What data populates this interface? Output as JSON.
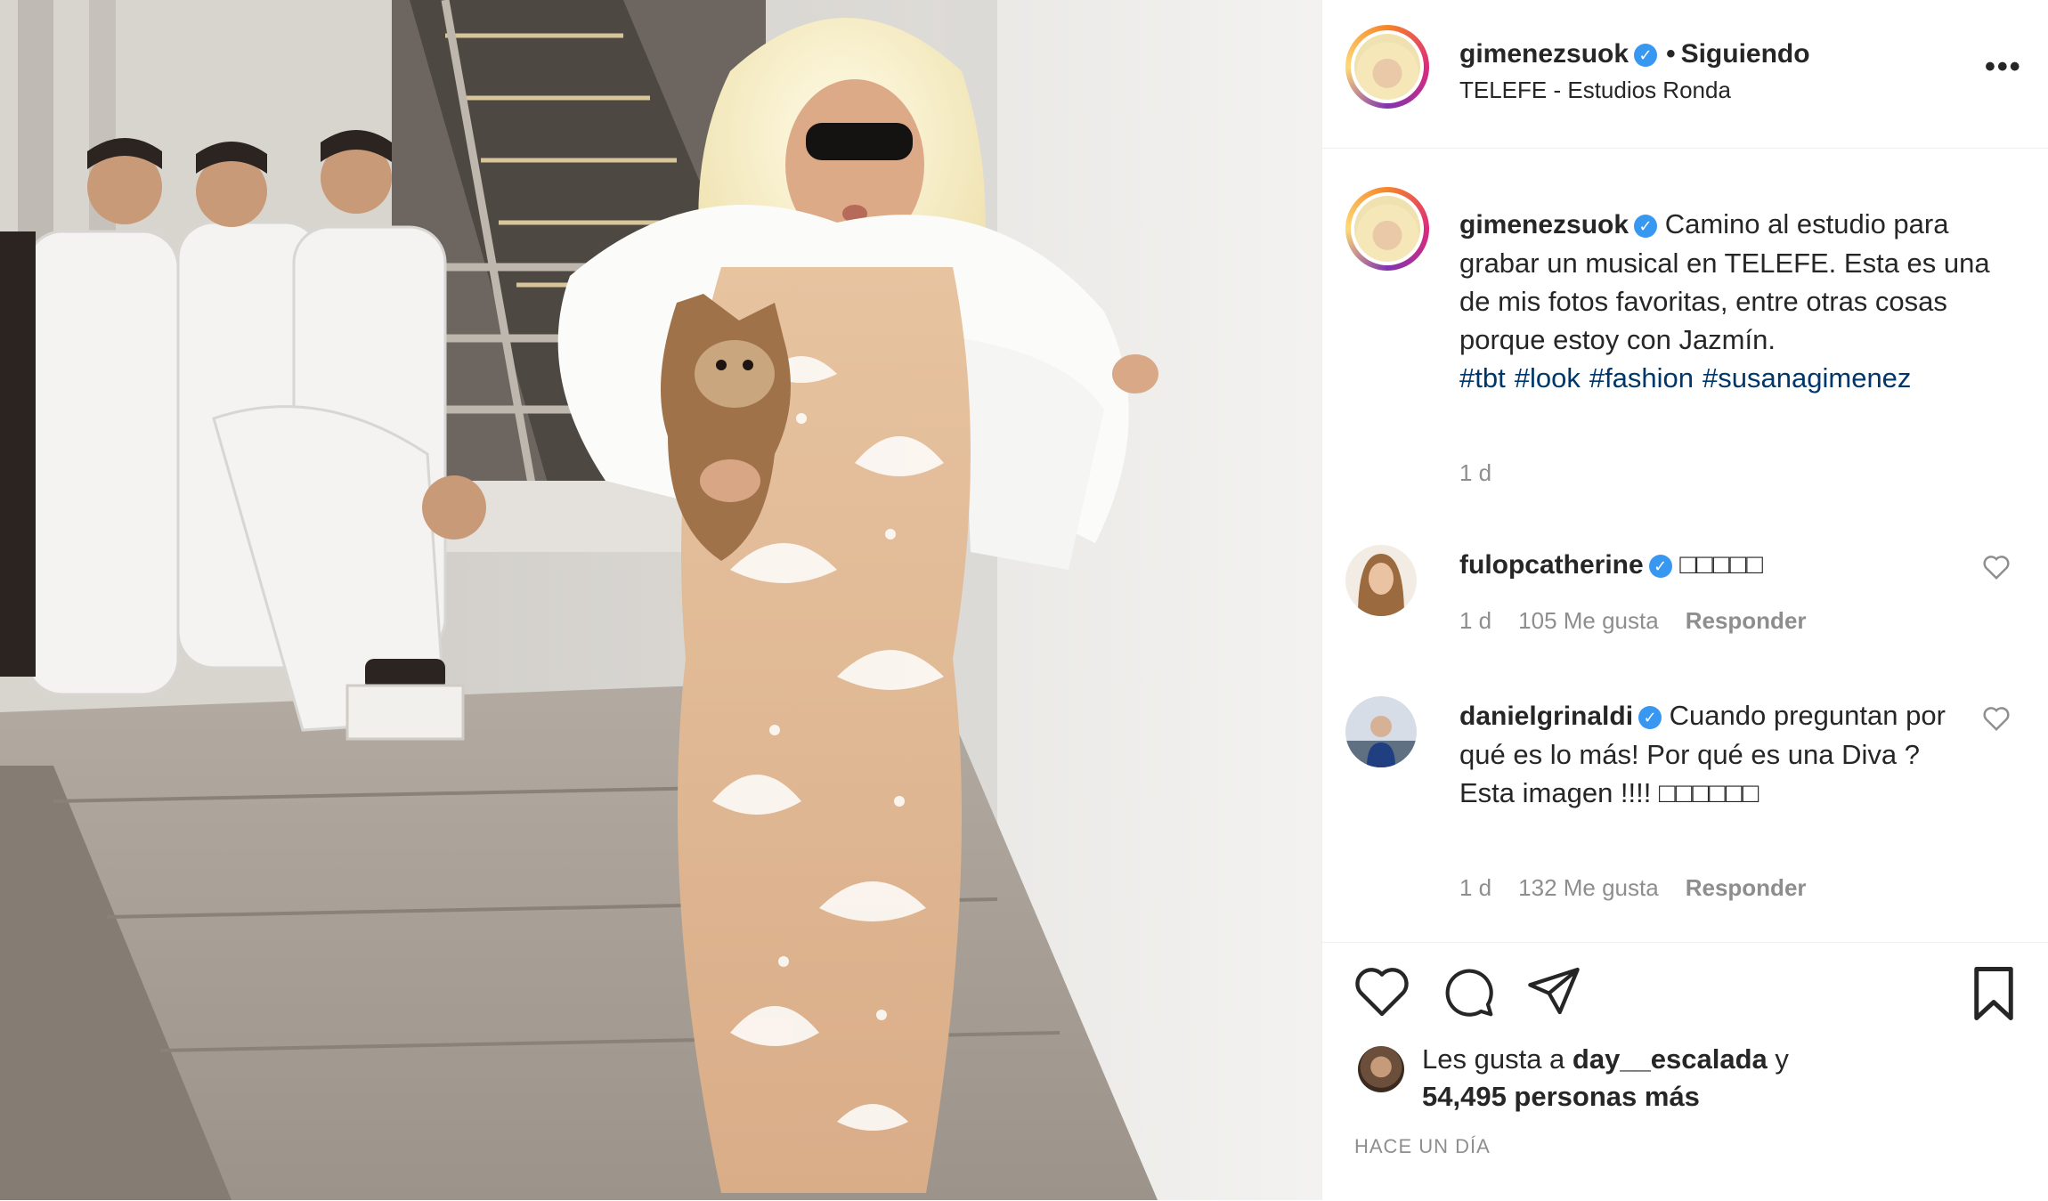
{
  "post": {
    "image_alt": "Mujer rubia con gafas oscuras, vestido de encaje y estola blanca de piel, sosteniendo un perro; detrás hombres con frac blanco"
  },
  "header": {
    "username": "gimenezsuok",
    "dot": "•",
    "follow_label": "Siguiendo",
    "location": "TELEFE - Estudios Ronda",
    "more_icon": "more-options-icon",
    "more_glyph": "•••"
  },
  "caption": {
    "username": "gimenezsuok",
    "text": "Camino al estudio para grabar un musical en TELEFE. Esta es una de mis fotos favoritas, entre otras cosas porque estoy con Jazmín.",
    "hashtags": [
      "#tbt",
      "#look",
      "#fashion",
      "#susanagimenez"
    ],
    "age": "1 d"
  },
  "comments": [
    {
      "username": "fulopcatherine",
      "text": "□□□□□",
      "age": "1 d",
      "likes": "105 Me gusta",
      "reply": "Responder"
    },
    {
      "username": "danielgrinaldi",
      "text": "Cuando preguntan por qué es lo más! Por qué es una Diva ? Esta imagen !!!! □□□□□□",
      "age": "1 d",
      "likes": "132 Me gusta",
      "reply": "Responder"
    }
  ],
  "actions": {
    "icons": [
      "like-icon",
      "comment-icon",
      "share-icon",
      "save-icon"
    ]
  },
  "likes": {
    "prefix": "Les gusta a ",
    "user": "day__escalada",
    "suffix": " y",
    "count_line": "54,495 personas más"
  },
  "timestamp": "HACE UN DÍA",
  "colors": {
    "verified": "#3897f0",
    "hashtag": "#00376b",
    "secondary_text": "#8e8e8e",
    "divider": "#efefef"
  }
}
